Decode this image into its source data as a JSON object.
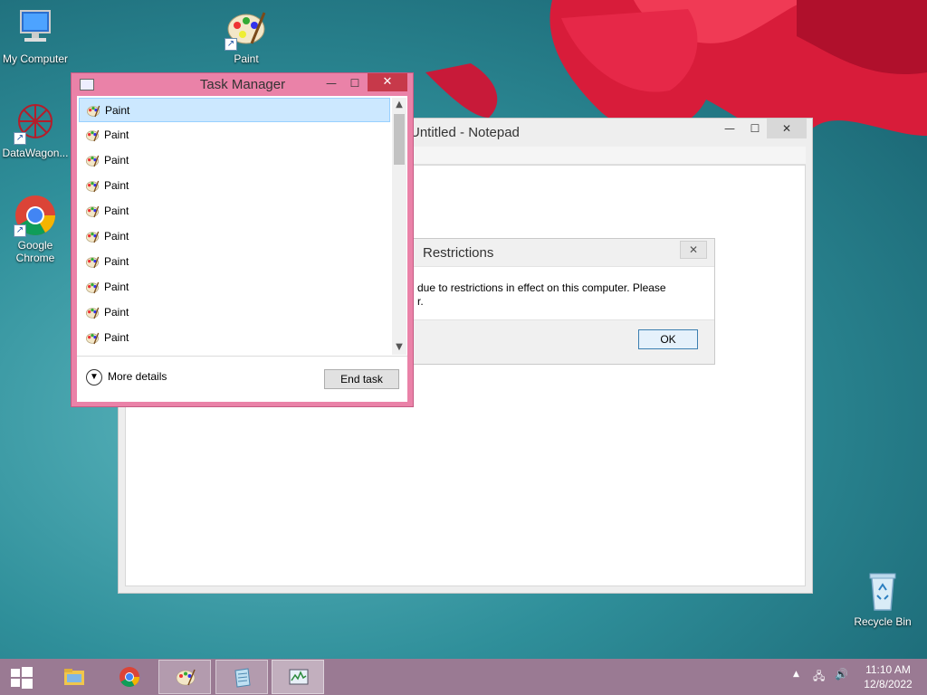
{
  "desktop": {
    "icons": [
      {
        "label": "My Computer"
      },
      {
        "label": "Paint"
      },
      {
        "label": "DataWagon..."
      },
      {
        "label": "Google Chrome"
      },
      {
        "label": "Recycle Bin"
      }
    ]
  },
  "notepad": {
    "title": "Untitled - Notepad"
  },
  "dialog": {
    "title": "Restrictions",
    "message_line1": "due to restrictions in effect on this computer. Please",
    "message_line2": "r.",
    "ok_label": "OK"
  },
  "task_manager": {
    "title": "Task Manager",
    "processes": [
      "Paint",
      "Paint",
      "Paint",
      "Paint",
      "Paint",
      "Paint",
      "Paint",
      "Paint",
      "Paint",
      "Paint"
    ],
    "more_details_label": "More details",
    "end_task_label": "End task"
  },
  "taskbar": {
    "items": [
      "start-button",
      "file-explorer",
      "google-chrome",
      "paint",
      "notepad",
      "task-manager"
    ],
    "active_item": "task-manager",
    "time": "11:10 AM",
    "date": "12/8/2022"
  },
  "colors": {
    "task_manager_frame": "#ea82a8",
    "close_button": "#c7394a",
    "taskbar": "#9a7a93",
    "selection": "#cce8ff"
  }
}
